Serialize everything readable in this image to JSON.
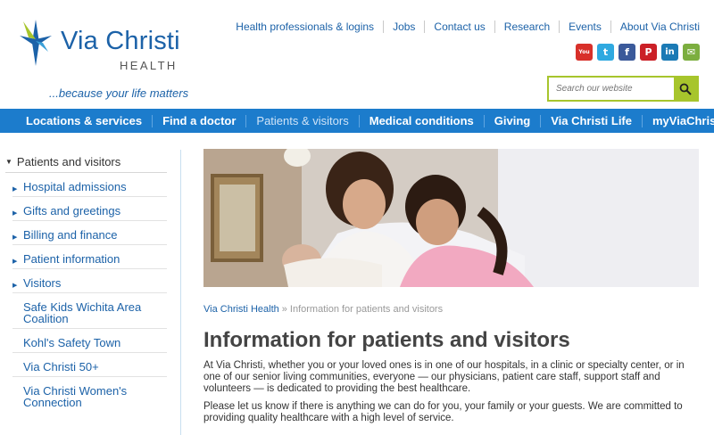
{
  "brand": {
    "name": "Via Christi",
    "sub": "HEALTH",
    "tagline": "...because your life matters"
  },
  "top_links": [
    "Health professionals & logins",
    "Jobs",
    "Contact us",
    "Research",
    "Events",
    "About Via Christi"
  ],
  "social": [
    {
      "icon": "youtube-icon",
      "glyph": "You",
      "color": "#d8302a"
    },
    {
      "icon": "twitter-icon",
      "glyph": "t",
      "color": "#2fa9e0"
    },
    {
      "icon": "facebook-icon",
      "glyph": "f",
      "color": "#3b5a9a"
    },
    {
      "icon": "pinterest-icon",
      "glyph": "P",
      "color": "#cb2027"
    },
    {
      "icon": "linkedin-icon",
      "glyph": "in",
      "color": "#1b7ab5"
    },
    {
      "icon": "share-icon",
      "glyph": "✉",
      "color": "#7cae3f"
    }
  ],
  "search": {
    "placeholder": "Search our website"
  },
  "nav": [
    {
      "label": "Locations & services",
      "active": false
    },
    {
      "label": "Find a doctor",
      "active": false
    },
    {
      "label": "Patients & visitors",
      "active": true
    },
    {
      "label": "Medical conditions",
      "active": false
    },
    {
      "label": "Giving",
      "active": false
    },
    {
      "label": "Via Christi Life",
      "active": false
    },
    {
      "label": "myViaChristi",
      "active": false
    }
  ],
  "sidebar": {
    "heading": "Patients and visitors",
    "items": [
      "Hospital admissions",
      "Gifts and greetings",
      "Billing and finance",
      "Patient information",
      "Visitors",
      "Safe Kids Wichita Area Coalition",
      "Kohl's Safety Town",
      "Via Christi 50+",
      "Via Christi Women's Connection"
    ]
  },
  "breadcrumb": {
    "home": "Via Christi Health",
    "separator": "»",
    "current": "Information for patients and visitors"
  },
  "page": {
    "title": "Information for patients and visitors",
    "paragraphs": [
      "At Via Christi, whether you or your loved ones is in one of our hospitals, in a clinic or specialty center, or in one of our senior living communities, everyone — our physicians, patient care staff, support staff and volunteers — is dedicated to providing the best healthcare.",
      "Please let us know if there is anything we can do for you, your family or your guests. We are committed to providing quality healthcare with a high level of service."
    ]
  },
  "colors": {
    "brand_blue": "#1c62a8",
    "nav_blue": "#1c7ccc",
    "accent_green": "#a7c52c"
  }
}
